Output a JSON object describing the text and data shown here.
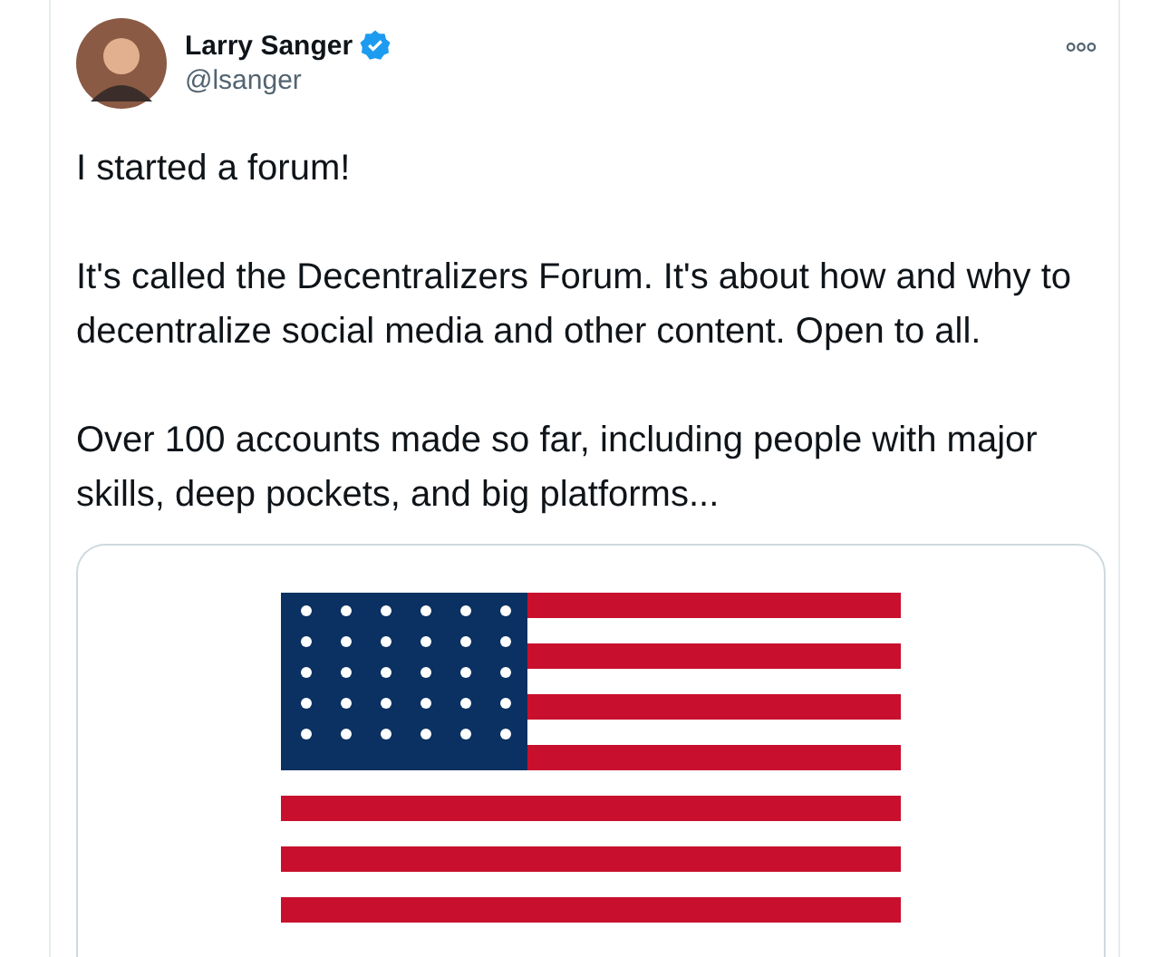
{
  "author": {
    "name": "Larry Sanger",
    "verified": true,
    "handle": "@lsanger"
  },
  "paragraphs": [
    "I started a forum!",
    "It's called the Decentralizers Forum. It's about how and why to decentralize social media and other content. Open to all.",
    "Over 100 accounts made so far, including people with major skills, deep pockets, and big platforms..."
  ]
}
